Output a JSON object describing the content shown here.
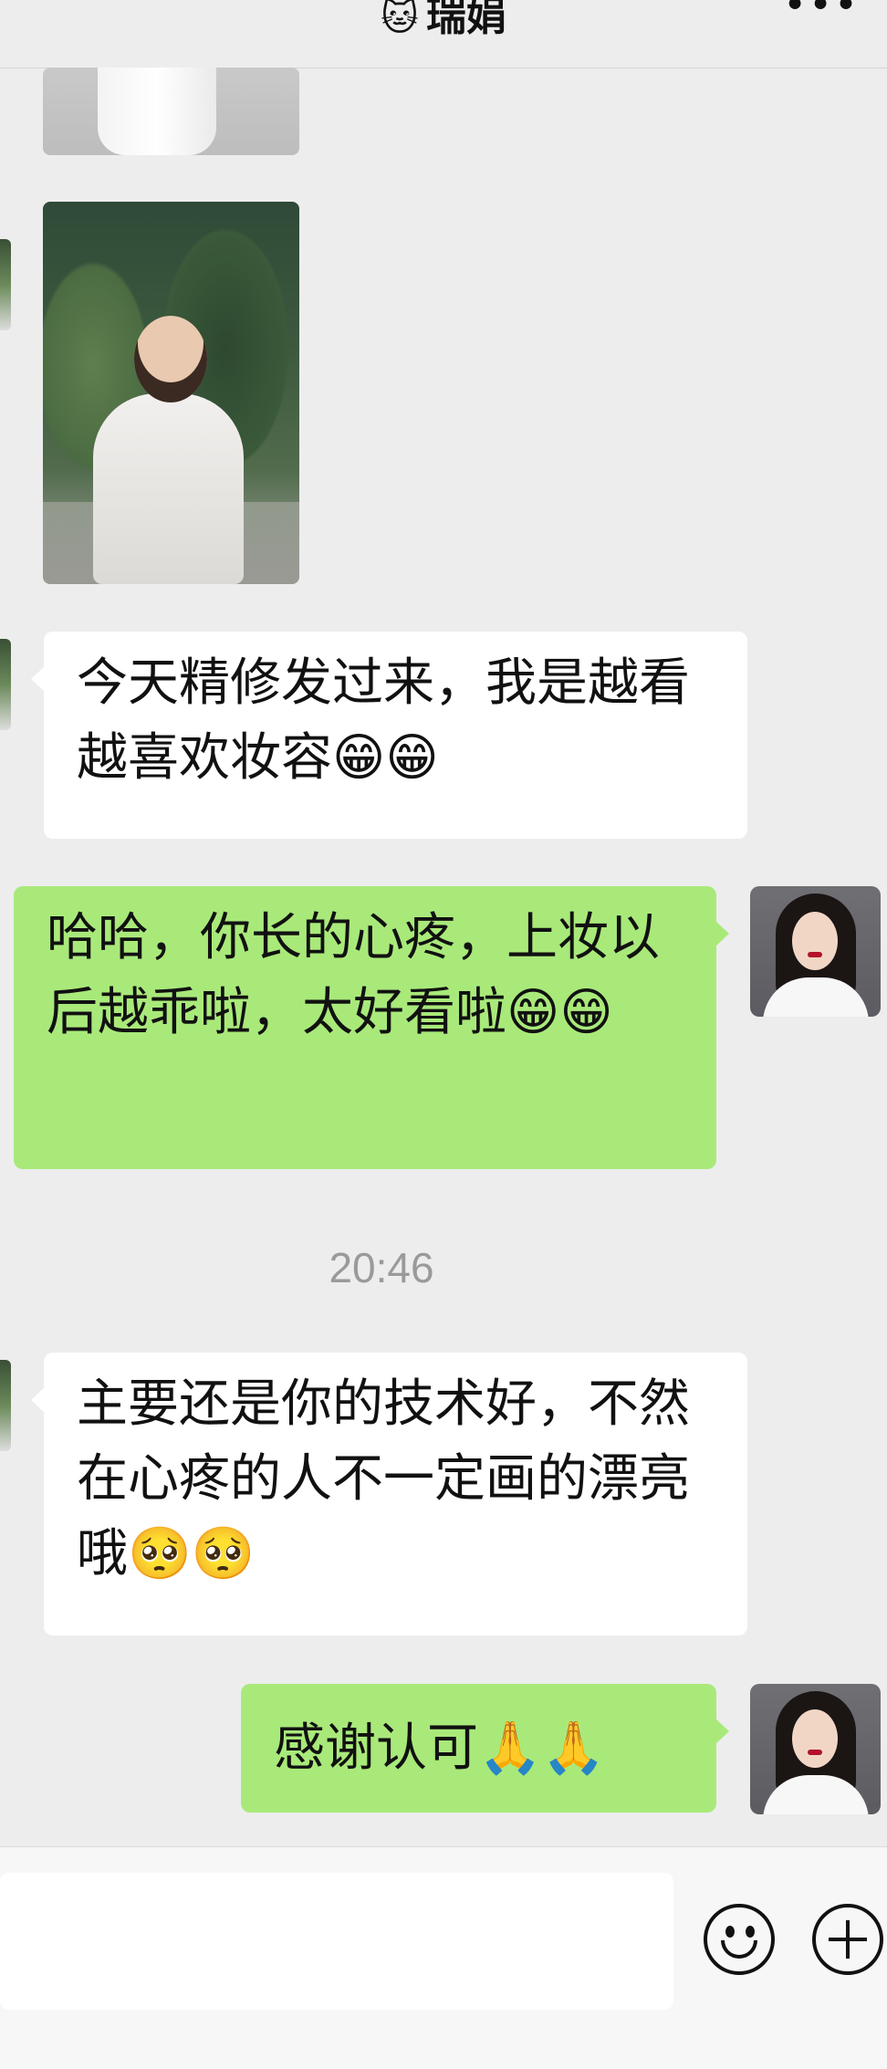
{
  "header": {
    "title_emoji": "🐱",
    "title": "瑞娟",
    "more": "•••"
  },
  "messages": [
    {
      "side": "left",
      "type": "image",
      "desc": "photo"
    },
    {
      "side": "left",
      "type": "image",
      "desc": "photo"
    },
    {
      "side": "left",
      "type": "text",
      "text": "今天精修发过来，我是越看越喜欢妆容😁😁"
    },
    {
      "side": "right",
      "type": "text",
      "text": "哈哈，你长的心疼，上妆以后越乖啦，太好看啦😁😁"
    },
    {
      "side": "left",
      "type": "text",
      "text": "主要还是你的技术好，不然在心疼的人不一定画的漂亮哦🥺🥺"
    },
    {
      "side": "right",
      "type": "text",
      "text": "感谢认可🙏🙏"
    }
  ],
  "timestamp": "20:46",
  "icons": {
    "emoji_button": "smile-icon",
    "add_button": "plus-circle-icon",
    "more": "more-icon"
  }
}
